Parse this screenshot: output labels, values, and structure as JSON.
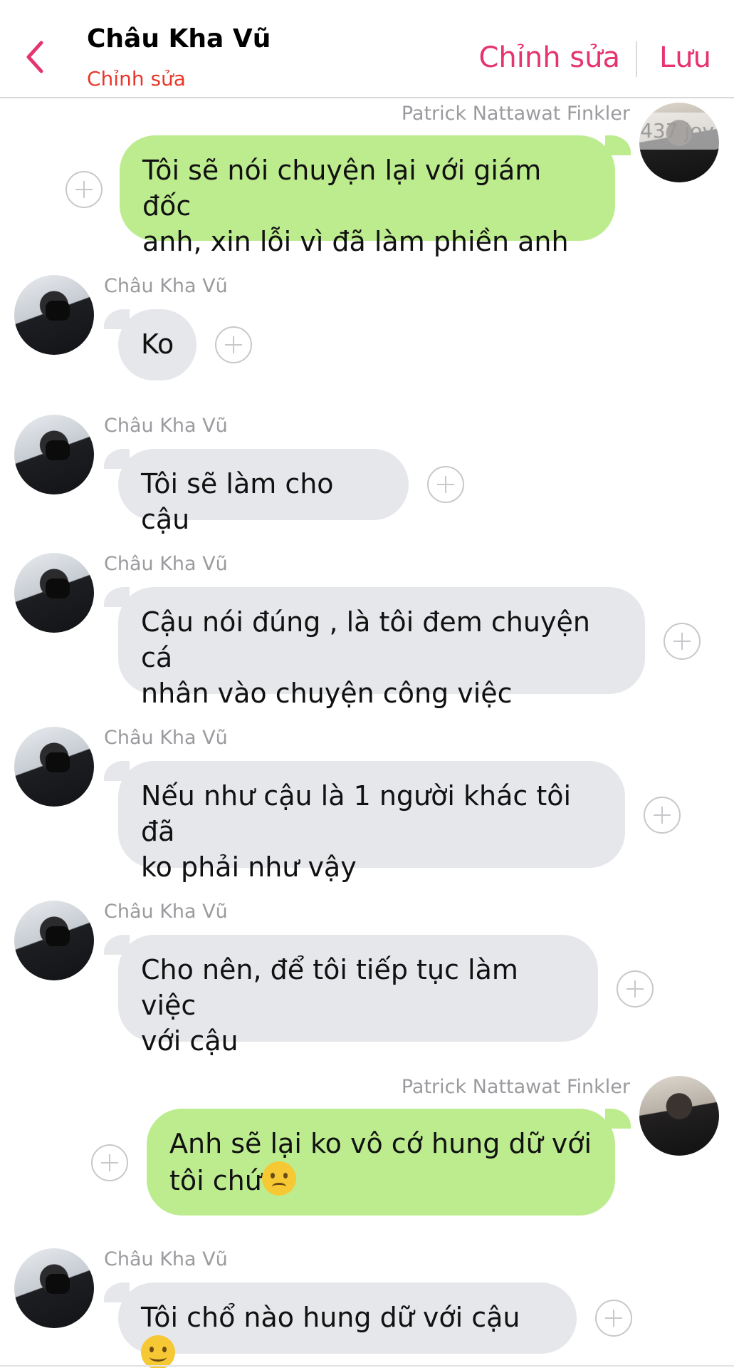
{
  "header": {
    "contact_name": "Châu Kha Vũ",
    "subtitle": "Chỉnh sửa",
    "edit_label": "Chỉnh sửa",
    "save_label": "Lưu",
    "accent_color": "#e5346e",
    "subtitle_color": "#e8382b"
  },
  "watermark": "437 joy",
  "messages": [
    {
      "sender": "Patrick Nattawat Finkler",
      "direction": "out",
      "lines": [
        "Tôi sẽ nói chuyện lại với giám đốc",
        "anh, xin lỗi vì đã làm phiền anh"
      ]
    },
    {
      "sender": "Châu Kha Vũ",
      "direction": "in",
      "lines": [
        "Ko"
      ]
    },
    {
      "sender": "Châu Kha Vũ",
      "direction": "in",
      "lines": [
        "Tôi sẽ làm cho cậu"
      ]
    },
    {
      "sender": "Châu Kha Vũ",
      "direction": "in",
      "lines": [
        "Cậu nói đúng , là tôi đem chuyện cá",
        "nhân vào chuyện công việc"
      ]
    },
    {
      "sender": "Châu Kha Vũ",
      "direction": "in",
      "lines": [
        "Nếu như cậu là 1 người khác tôi đã",
        "ko phải như vậy"
      ]
    },
    {
      "sender": "Châu Kha Vũ",
      "direction": "in",
      "lines": [
        "Cho nên, để tôi tiếp tục làm việc",
        "với cậu"
      ]
    },
    {
      "sender": "Patrick Nattawat Finkler",
      "direction": "out",
      "lines": [
        "Anh sẽ lại ko vô cớ hung dữ  với",
        "tôi chứ"
      ],
      "emoji": "sad-face"
    },
    {
      "sender": "Châu Kha Vũ",
      "direction": "in",
      "lines": [
        "Tôi chổ nào hung dữ với cậu"
      ],
      "emoji": "smile-face"
    }
  ],
  "colors": {
    "incoming_bubble": "#e5e7ea",
    "outgoing_bubble": "#bdec8f",
    "sender_name": "#9b9b9f"
  }
}
